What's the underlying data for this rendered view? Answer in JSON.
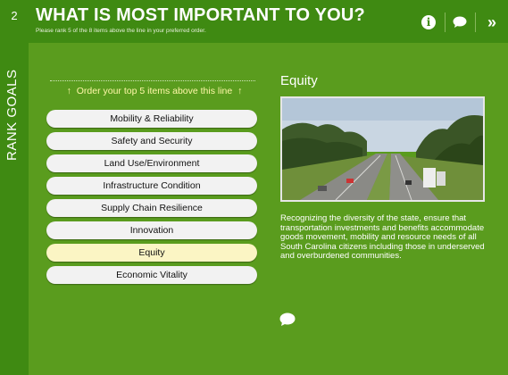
{
  "header": {
    "step_number": "2",
    "title": "WHAT IS MOST IMPORTANT TO YOU?",
    "subtitle": "Please rank 5 of the 8 items above the line in your preferred order.",
    "side_label": "RANK GOALS",
    "icons": [
      "info-icon",
      "comment-icon",
      "next-icon"
    ],
    "next_glyph": "»"
  },
  "instruction": {
    "text": "Order your top 5 items above this line",
    "arrow": "↑"
  },
  "items": [
    {
      "label": "Mobility & Reliability"
    },
    {
      "label": "Safety and Security"
    },
    {
      "label": "Land Use/Environment"
    },
    {
      "label": "Infrastructure Condition"
    },
    {
      "label": "Supply Chain Resilience"
    },
    {
      "label": "Innovation"
    },
    {
      "label": "Equity",
      "selected": true
    },
    {
      "label": "Economic Vitality"
    }
  ],
  "detail": {
    "title": "Equity",
    "description": "Recognizing the diversity of the state, ensure that transportation investments and benefits accommodate goods movement, mobility and resource needs of all South Carolina citizens including those in underserved and overburdened communities.",
    "image": "highway-photo"
  },
  "colors": {
    "background": "#5a9c1e",
    "header": "#3f8a12",
    "instruction": "#fff7a8",
    "selected_item": "#fbf5c4"
  }
}
